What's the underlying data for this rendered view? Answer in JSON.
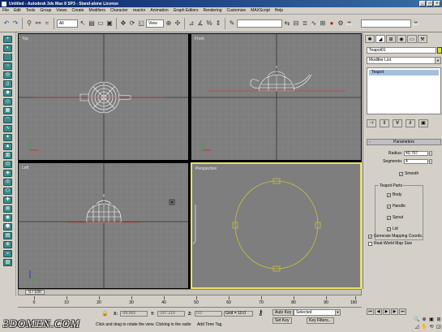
{
  "window": {
    "title": "Untitled - Autodesk 3ds Max 8 SP3 - Stand-alone License",
    "buttons": [
      "_",
      "□",
      "×"
    ]
  },
  "menu": [
    "File",
    "Edit",
    "Tools",
    "Group",
    "Views",
    "Create",
    "Modifiers",
    "Character",
    "reactor",
    "Animation",
    "Graph Editors",
    "Rendering",
    "Customize",
    "MAXScript",
    "Help"
  ],
  "toolbar": {
    "selection_filter": "All",
    "ref_coord": "View",
    "named_sets": "",
    "icons": [
      "undo-icon",
      "redo-icon",
      "link-icon",
      "unlink-icon",
      "bind-icon",
      "select-icon",
      "select-by-name-icon",
      "rect-region-icon",
      "window-crossing-icon",
      "move-icon",
      "rotate-icon",
      "scale-icon",
      "pivot-icon",
      "select-manipulate-icon",
      "snap-icon",
      "angle-snap-icon",
      "percent-snap-icon",
      "spinner-snap-icon",
      "mirror-icon",
      "align-icon",
      "layer-icon",
      "curve-editor-icon",
      "schematic-icon",
      "material-editor-icon",
      "render-setup-icon",
      "quick-render-icon"
    ]
  },
  "viewports": {
    "top": {
      "label": "Top"
    },
    "front": {
      "label": "Front"
    },
    "left": {
      "label": "Left"
    },
    "perspective": {
      "label": "Perspective"
    }
  },
  "command_panel": {
    "object_name": "Teapot01",
    "object_color": "#e0e020",
    "modifier_list": "Modifier List",
    "stack_item": "Teapot",
    "rollout_title": "Parameters",
    "radius_label": "Radius:",
    "radius_value": "40.767",
    "segments_label": "Segments:",
    "segments_value": "4",
    "smooth_label": "Smooth",
    "teapot_parts_label": "Teapot Parts",
    "parts": [
      "Body",
      "Handle",
      "Spout",
      "Lid"
    ],
    "gen_mapping": "Generate Mapping Coords.",
    "real_world": "Real-World Map Size"
  },
  "timeline": {
    "frame_display": "0 / 100",
    "ticks": [
      "0",
      "10",
      "20",
      "30",
      "40",
      "50",
      "60",
      "70",
      "80",
      "90",
      "100"
    ]
  },
  "status": {
    "logo": "3DOMEN.COM",
    "x_label": "X:",
    "x_value": "-98.569",
    "y_label": "Y:",
    "y_value": "-267.219",
    "z_label": "Z:",
    "z_value": "0.0",
    "grid_label": "Grid = 10.0",
    "auto_key": "Auto Key",
    "set_key": "Set Key",
    "key_mode": "Selected",
    "key_filters": "Key Filters...",
    "prompt": "Click and drag to rotate the view.  Clicking in the radio",
    "add_time_tag": "Add Time Tag"
  }
}
